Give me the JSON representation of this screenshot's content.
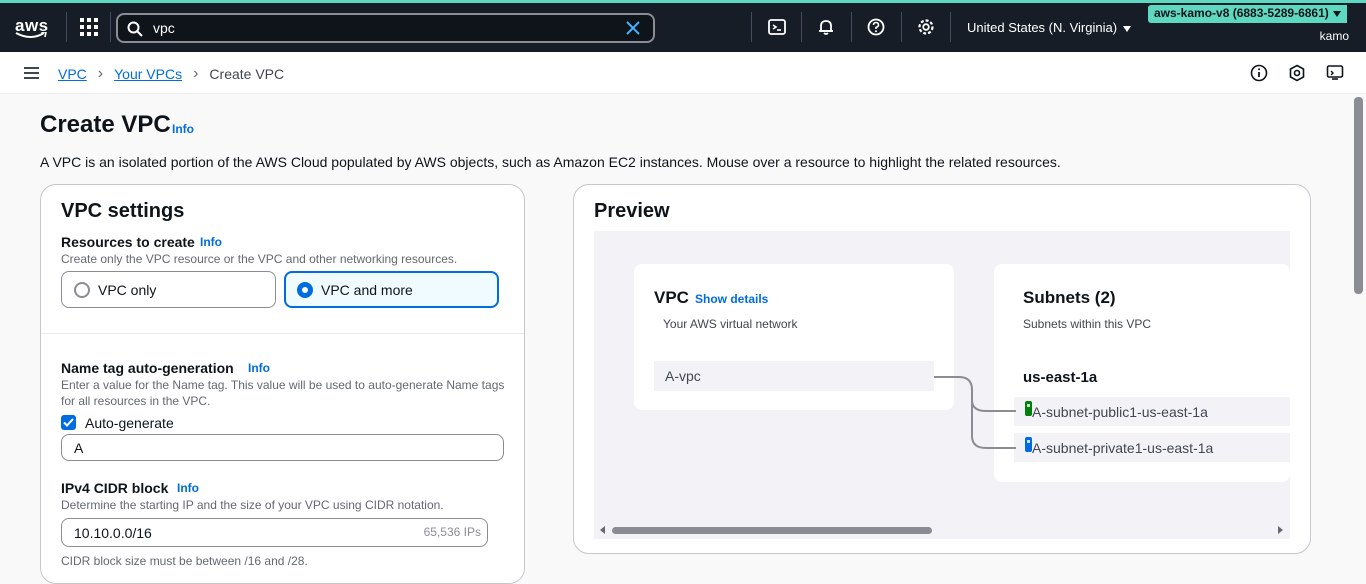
{
  "topnav": {
    "logo": "aws",
    "search_value": "vpc",
    "region": "United States (N. Virginia)",
    "account": "aws-kamo-v8 (6883-5289-6861)",
    "user": "kamo"
  },
  "breadcrumb": {
    "items": [
      "VPC",
      "Your VPCs"
    ],
    "current": "Create VPC"
  },
  "page": {
    "title": "Create VPC",
    "info": "Info",
    "description": "A VPC is an isolated portion of the AWS Cloud populated by AWS objects, such as Amazon EC2 instances. Mouse over a resource to highlight the related resources."
  },
  "settings": {
    "title": "VPC settings",
    "resources_label": "Resources to create",
    "resources_info": "Info",
    "resources_desc": "Create only the VPC resource or the VPC and other networking resources.",
    "option_vpc_only": "VPC only",
    "option_vpc_more": "VPC and more",
    "nametag_label": "Name tag auto-generation",
    "nametag_info": "Info",
    "nametag_desc": "Enter a value for the Name tag. This value will be used to auto-generate Name tags for all resources in the VPC.",
    "autogenerate_label": "Auto-generate",
    "nametag_value": "A",
    "cidr_label": "IPv4 CIDR block",
    "cidr_info": "Info",
    "cidr_desc": "Determine the starting IP and the size of your VPC using CIDR notation.",
    "cidr_value": "10.10.0.0/16",
    "cidr_suffix": "65,536 IPs",
    "cidr_hint": "CIDR block size must be between /16 and /28."
  },
  "preview": {
    "title": "Preview",
    "vpc_title": "VPC",
    "vpc_show_details": "Show details",
    "vpc_sub": "Your AWS virtual network",
    "vpc_name": "A-vpc",
    "subnets_title": "Subnets (2)",
    "subnets_sub": "Subnets within this VPC",
    "az": "us-east-1a",
    "subnet_public": "A-subnet-public1-us-east-1a",
    "subnet_private": "A-subnet-private1-us-east-1a"
  },
  "colors": {
    "topbar": "#161d26",
    "accent": "#5ed8c0",
    "link": "#006ce0",
    "public_subnet": "#037f0c",
    "private_subnet": "#006ce0"
  }
}
